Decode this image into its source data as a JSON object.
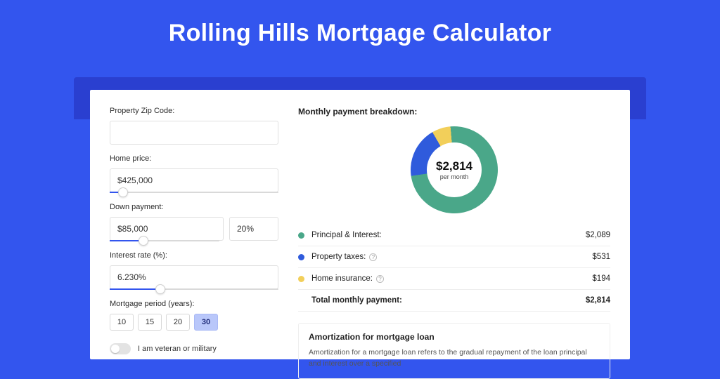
{
  "hero": {
    "title": "Rolling Hills Mortgage Calculator"
  },
  "form": {
    "zip": {
      "label": "Property Zip Code:",
      "value": ""
    },
    "price": {
      "label": "Home price:",
      "value": "$425,000",
      "slider_pct": 8
    },
    "down": {
      "label": "Down payment:",
      "value": "$85,000",
      "pct_value": "20%",
      "slider_pct": 20
    },
    "rate": {
      "label": "Interest rate (%):",
      "value": "6.230%",
      "slider_pct": 30
    },
    "period": {
      "label": "Mortgage period (years):",
      "options": [
        "10",
        "15",
        "20",
        "30"
      ],
      "selected": "30"
    },
    "veteran": {
      "label": "I am veteran or military",
      "on": false
    }
  },
  "breakdown": {
    "title": "Monthly payment breakdown:",
    "center_value": "$2,814",
    "center_sub": "per month",
    "items": [
      {
        "key": "pi",
        "label": "Principal & Interest:",
        "amount": "$2,089",
        "color": "#4aa789",
        "info": false
      },
      {
        "key": "tax",
        "label": "Property taxes:",
        "amount": "$531",
        "color": "#2f5bdc",
        "info": true
      },
      {
        "key": "ins",
        "label": "Home insurance:",
        "amount": "$194",
        "color": "#f2cf5a",
        "info": true
      }
    ],
    "total": {
      "label": "Total monthly payment:",
      "amount": "$2,814"
    }
  },
  "amortization": {
    "title": "Amortization for mortgage loan",
    "body": "Amortization for a mortgage loan refers to the gradual repayment of the loan principal and interest over a specified"
  },
  "chart_data": {
    "type": "pie",
    "title": "Monthly payment breakdown",
    "categories": [
      "Principal & Interest",
      "Property taxes",
      "Home insurance"
    ],
    "values": [
      2089,
      531,
      194
    ],
    "total": 2814,
    "unit": "$ per month"
  }
}
